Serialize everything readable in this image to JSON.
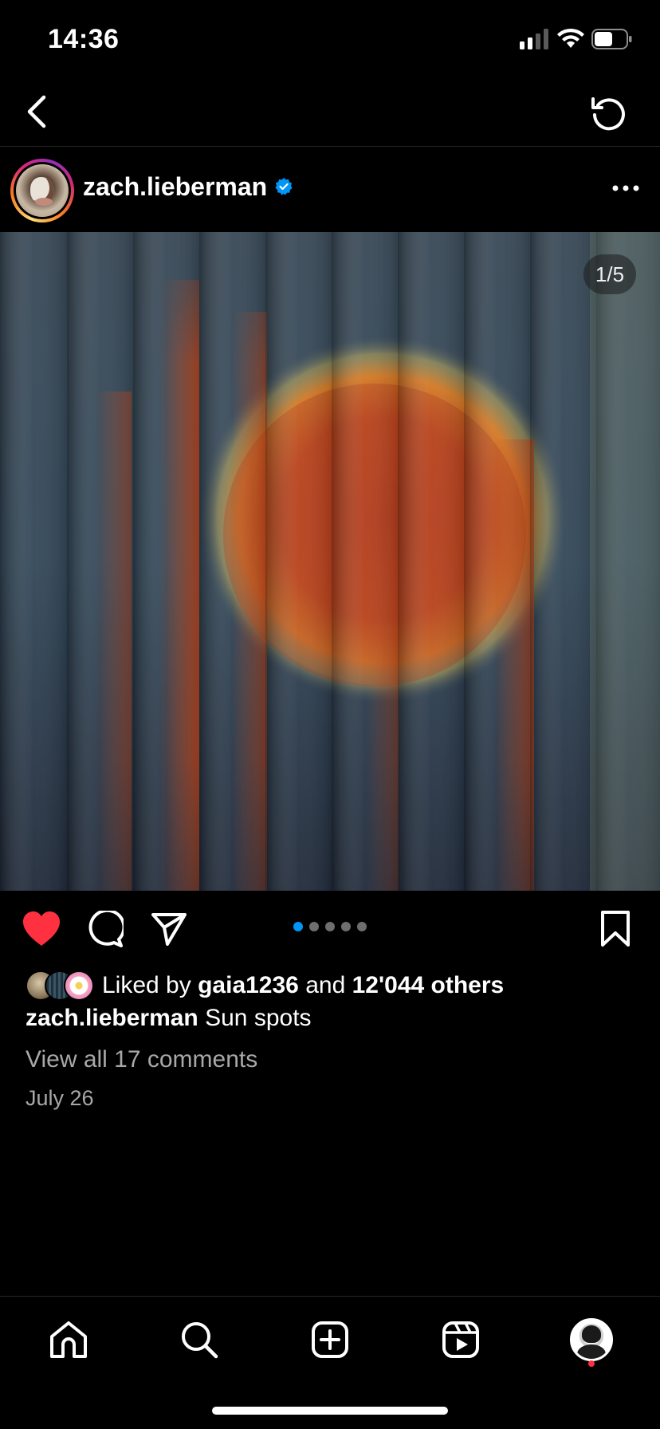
{
  "status_bar": {
    "time": "14:36"
  },
  "post": {
    "username": "zach.lieberman",
    "verified": true,
    "image_counter": "1/5",
    "carousel": {
      "total": 5,
      "active_index": 0
    },
    "likes": {
      "prefix": "Liked by",
      "user": "gaia1236",
      "connector": "and",
      "others": "12'044 others"
    },
    "caption": {
      "username": "zach.lieberman",
      "text": "Sun spots"
    },
    "view_comments": "View all 17 comments",
    "date": "July 26",
    "liked": true
  },
  "icons": {
    "back": "chevron-left-icon",
    "refresh": "refresh-icon",
    "more": "more-horizontal-icon",
    "like": "heart-icon",
    "comment": "comment-icon",
    "share": "send-icon",
    "save": "bookmark-icon",
    "tabs": [
      "home-icon",
      "search-icon",
      "plus-square-icon",
      "reels-icon",
      "profile-avatar"
    ]
  },
  "colors": {
    "background": "#000000",
    "like_red": "#ff3040",
    "accent_blue": "#0095f6",
    "muted_text": "#a8a8a8"
  }
}
